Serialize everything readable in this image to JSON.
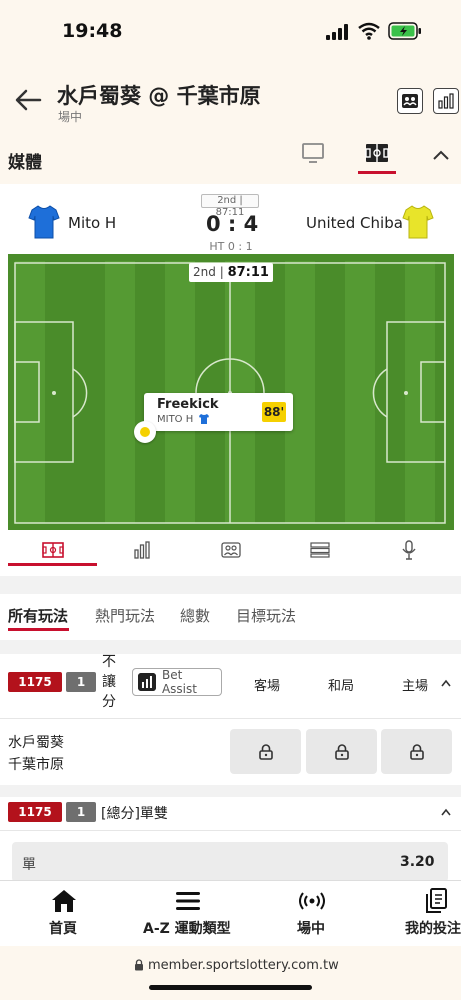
{
  "status": {
    "time": "19:48"
  },
  "header": {
    "title": "水戶蜀葵 @ 千葉市原",
    "subtitle": "場中"
  },
  "media": {
    "label": "媒體"
  },
  "match": {
    "period": "2nd | 87:11",
    "home": "Mito H",
    "away": "United Chiba",
    "score": "0 : 4",
    "halftime": "HT 0 : 1",
    "home_color": "#1e6fd9",
    "away_color": "#e8e42a"
  },
  "pitch": {
    "half": "2nd",
    "clock": "87:11",
    "event_title": "Freekick",
    "event_team": "MITO H",
    "event_minute": "88'"
  },
  "market_tabs": [
    "所有玩法",
    "熱門玩法",
    "總數",
    "目標玩法"
  ],
  "market1": {
    "code": "1175",
    "num": "1",
    "name": "不讓分",
    "bet_assist": "Bet Assist",
    "col_away": "客場",
    "col_draw": "和局",
    "col_home": "主場",
    "team1": "水戶蜀葵",
    "team2": "千葉市原"
  },
  "market2": {
    "code": "1175",
    "num": "1",
    "name": "[總分]單雙",
    "option": "單",
    "odds": "3.20"
  },
  "nav": [
    {
      "label": "首頁",
      "icon": "home-icon"
    },
    {
      "label": "A-Z 運動類型",
      "icon": "menu-icon"
    },
    {
      "label": "場中",
      "icon": "live-icon"
    },
    {
      "label": "我的投注",
      "icon": "bets-icon"
    }
  ],
  "url": "member.sportslottery.com.tw",
  "colors": {
    "accent": "#c8102e",
    "code_red": "#b3121c",
    "pitch": "#4a8c2a"
  }
}
